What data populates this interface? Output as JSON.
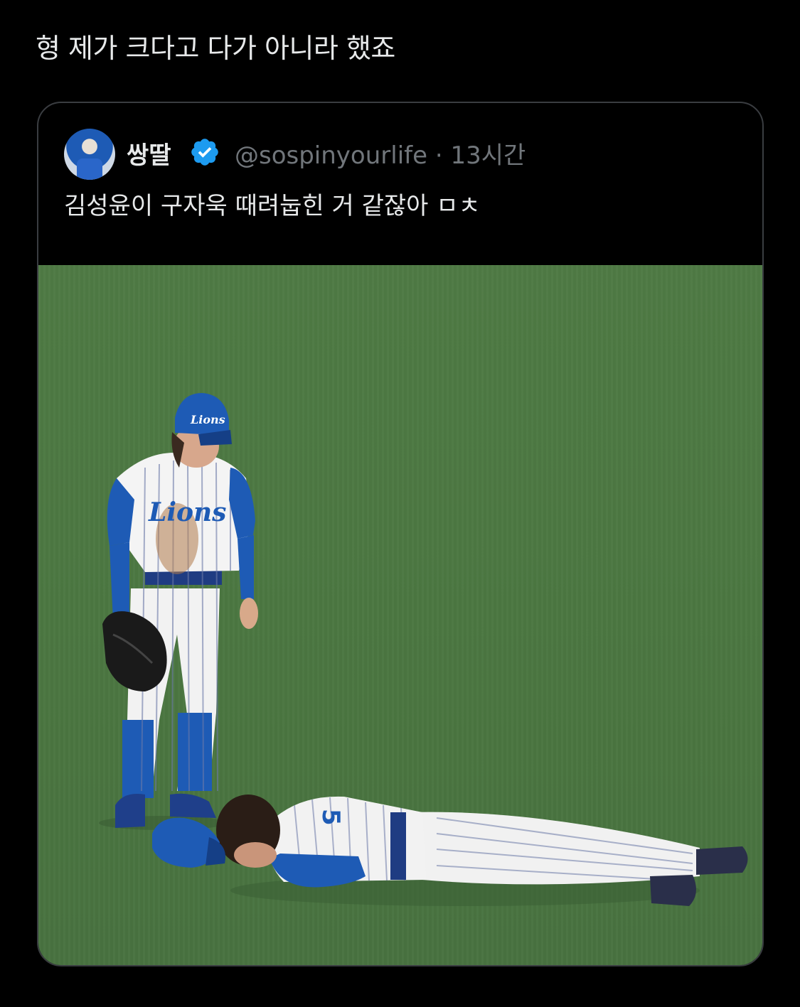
{
  "post": {
    "text": "형 제가 크다고 다가 아니라 했죠"
  },
  "quoted": {
    "display_name": "쌍딸",
    "handle": "@sospinyourlife",
    "separator": "·",
    "time": "13시간",
    "text": "김성윤이 구자욱 때려눕힌 거 같잖아 ㅁㅊ",
    "verified_color": "#1d9bf0"
  },
  "media": {
    "cap_logo": "Lions",
    "jersey_logo": "Lions"
  }
}
